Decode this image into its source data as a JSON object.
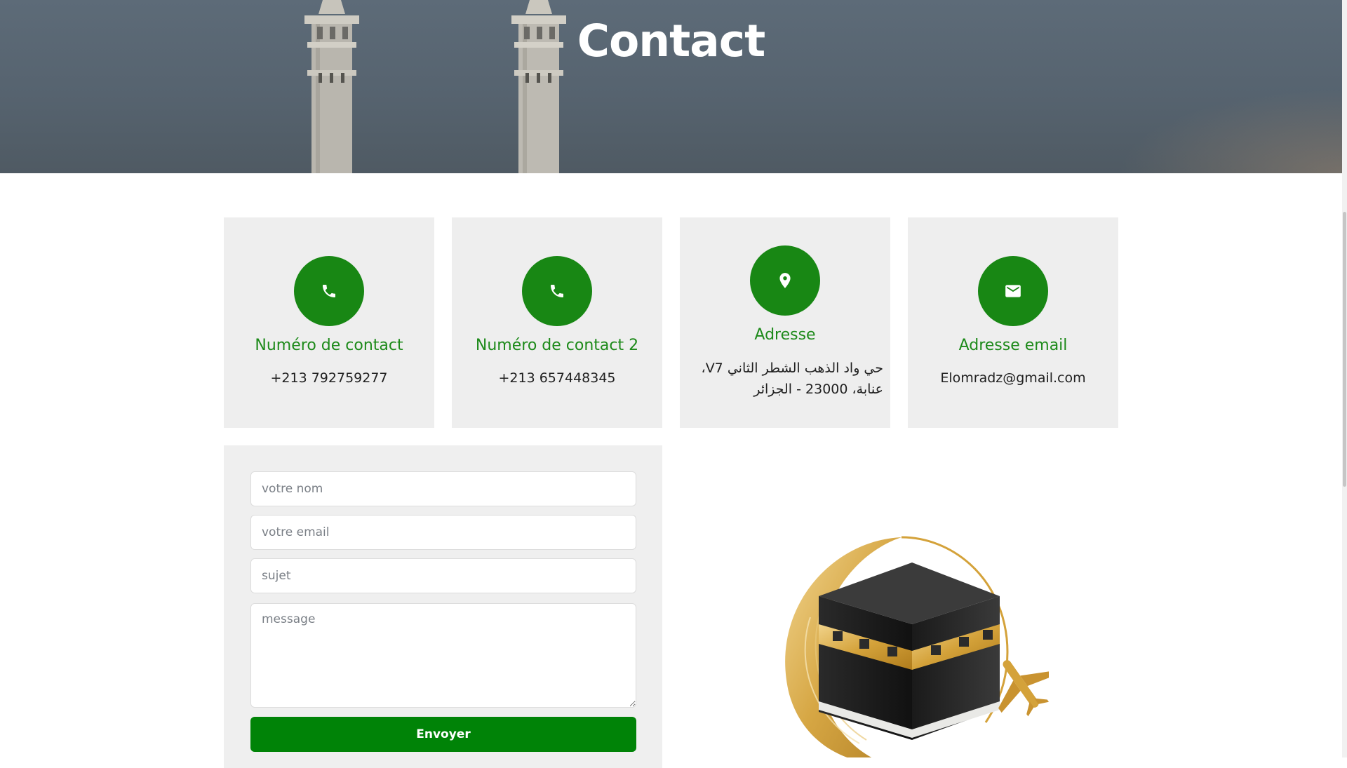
{
  "hero": {
    "title": "Contact"
  },
  "cards": [
    {
      "icon": "phone-icon",
      "title": "Numéro de contact",
      "text": "+213 792759277"
    },
    {
      "icon": "phone-icon",
      "title": "Numéro de contact 2",
      "text": "+213 657448345"
    },
    {
      "icon": "location-pin-icon",
      "title": "Adresse",
      "text_line1": "حي واد الذهب الشطر الثاني V7،",
      "text_line2": "عنابة، 23000 - الجزائر"
    },
    {
      "icon": "mail-icon",
      "title": "Adresse email",
      "text": "Elomradz@gmail.com"
    }
  ],
  "form": {
    "name_placeholder": "votre nom",
    "email_placeholder": "votre email",
    "subject_placeholder": "sujet",
    "message_placeholder": "message",
    "submit_label": "Envoyer"
  },
  "colors": {
    "accent_green": "#188714",
    "button_green": "#008307",
    "card_bg": "#eeeeee",
    "gold": "#d4a23a"
  }
}
